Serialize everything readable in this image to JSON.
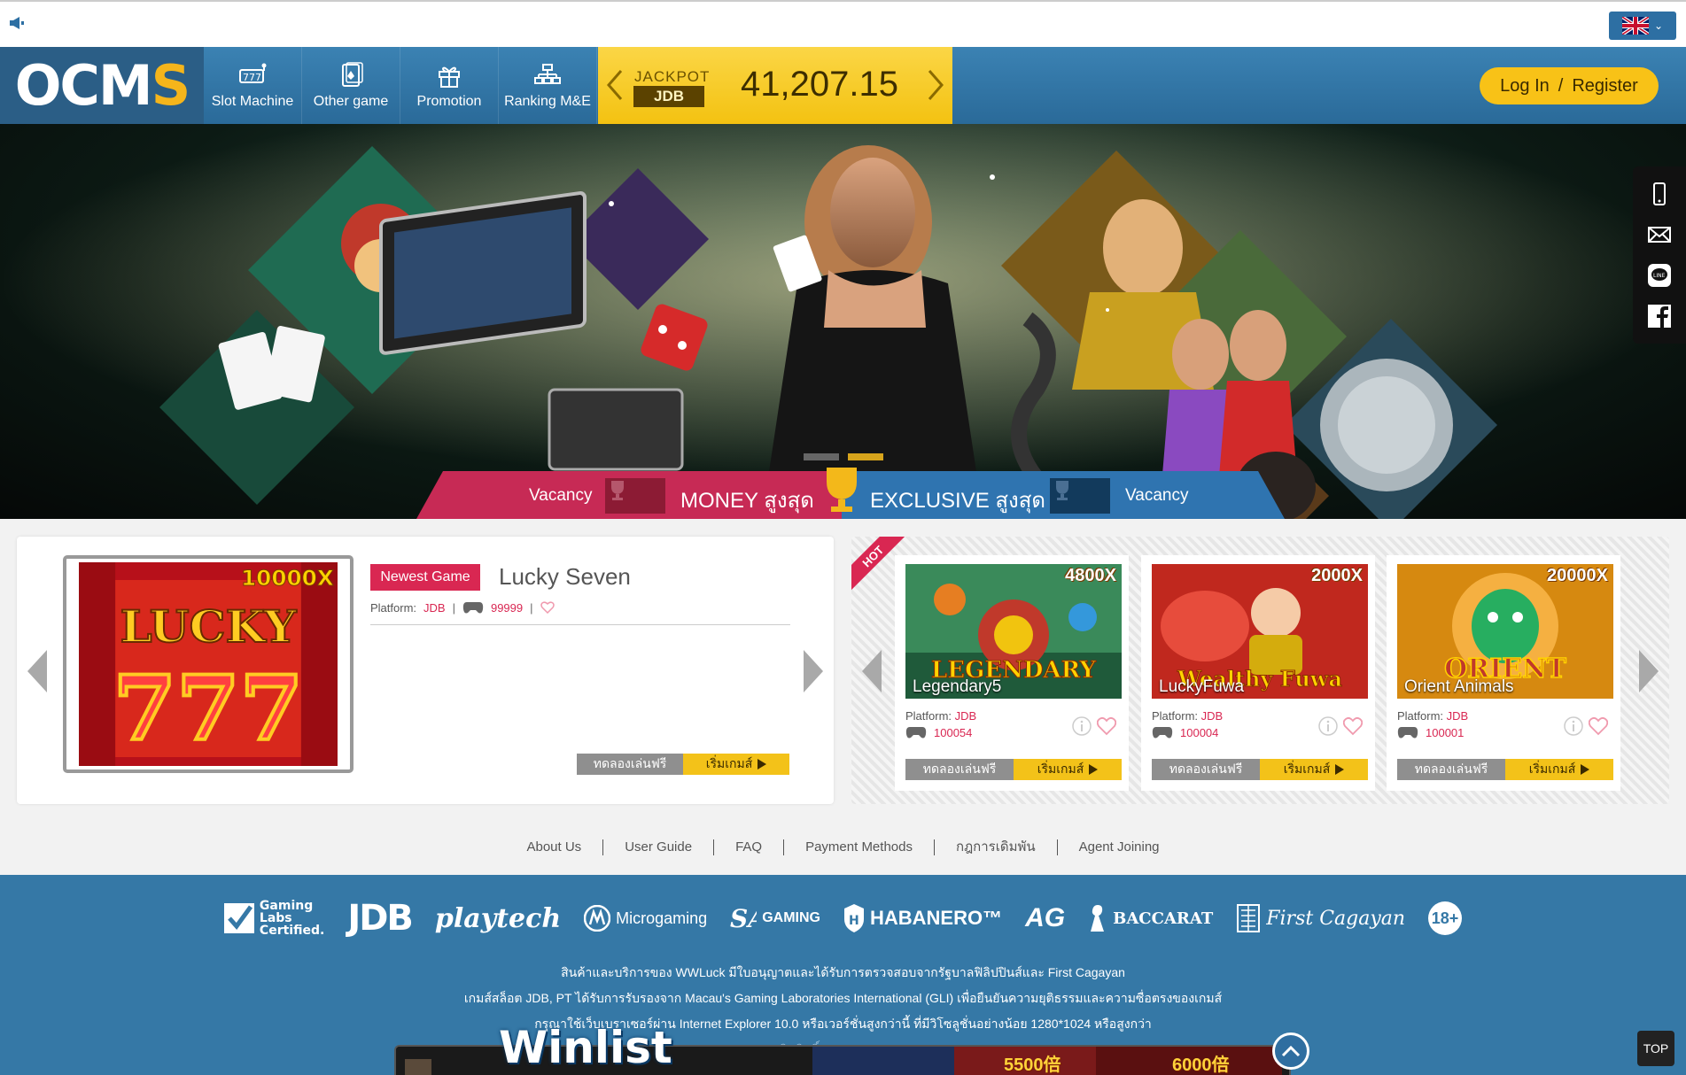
{
  "header": {
    "logo_main": "OCM",
    "logo_accent": "S",
    "nav": [
      {
        "label": "Slot Machine",
        "icon": "slot-icon"
      },
      {
        "label": "Other game",
        "icon": "cards-icon"
      },
      {
        "label": "Promotion",
        "icon": "gift-icon"
      },
      {
        "label": "Ranking M&E",
        "icon": "ranking-icon"
      }
    ],
    "jackpot": {
      "label": "JACKPOT",
      "provider": "JDB",
      "value": "41,207.15"
    },
    "login": {
      "login_label": "Log In",
      "separator": "/",
      "register_label": "Register"
    },
    "language": "flag-uk-icon"
  },
  "banner": {
    "slides_total": 2,
    "active_slide": 2,
    "rank_strip": {
      "left_vacancy": "Vacancy",
      "money_label": "MONEY สูงสุด",
      "exclusive_label": "EXCLUSIVE สูงสุด",
      "right_vacancy": "Vacancy"
    }
  },
  "side_tools": [
    "mobile-icon",
    "mail-icon",
    "line-icon",
    "facebook-icon"
  ],
  "newest_game": {
    "badge": "Newest Game",
    "title": "Lucky Seven",
    "platform_label": "Platform:",
    "platform": "JDB",
    "players": "99999",
    "thumb_multiplier": "10000X",
    "thumb_text_1": "LUCKY",
    "thumb_text_2": "777",
    "try_label": "ทดลองเล่นฟรี",
    "play_label": "เริ่มเกมส์"
  },
  "hot_games": {
    "ribbon": "HOT",
    "games": [
      {
        "name": "Legendary5",
        "multiplier": "4800X",
        "platform_label": "Platform:",
        "platform": "JDB",
        "players": "100054",
        "try_label": "ทดลองเล่นฟรี",
        "play_label": "เริ่มเกมส์"
      },
      {
        "name": "LuckyFuwa",
        "multiplier": "2000X",
        "platform_label": "Platform:",
        "platform": "JDB",
        "players": "100004",
        "try_label": "ทดลองเล่นฟรี",
        "play_label": "เริ่มเกมส์"
      },
      {
        "name": "Orient Animals",
        "multiplier": "20000X",
        "platform_label": "Platform:",
        "platform": "JDB",
        "players": "100001",
        "try_label": "ทดลองเล่นฟรี",
        "play_label": "เริ่มเกมส์"
      }
    ]
  },
  "footer_links": [
    "About Us",
    "User Guide",
    "FAQ",
    "Payment Methods",
    "กฎการเดิมพัน",
    "Agent Joining"
  ],
  "partners": {
    "glc": [
      "Gaming",
      "Labs",
      "Certified."
    ],
    "jdb": "JDB",
    "playtech": "playtech",
    "microgaming": "Microgaming",
    "sa_gaming": "GAMING",
    "habanero": "HABANERO™",
    "ag": "AG",
    "sexy_baccarat": "BACCARAT",
    "first_cagayan": "First Cagayan",
    "age": "18+"
  },
  "footer_text": {
    "line1": "สินค้าและบริการของ WWLuck มีใบอนุญาตและได้รับการตรวจสอบจากรัฐบาลฟิลิปปินส์และ First Cagayan",
    "line2": "เกมส์สล็อต JDB, PT ได้รับการรับรองจาก Macau's Gaming Laboratories International (GLI) เพื่อยืนยันความยุติธรรมและความซื่อตรงของเกมส์",
    "line3": "กรุณาใช้เว็บเบราเซอร์ผ่าน Internet Explorer 10.0 หรือเวอร์ชั่นสูงกว่านี้ ที่มีวิโซลูชั่นอย่างน้อย 1280*1024 หรือสูงกว่า",
    "copyright": "ลิขสิทธิ์ของ © WWLuck"
  },
  "winlist": {
    "title": "Winlist",
    "mult_1": "5500倍",
    "mult_2": "6000倍"
  },
  "top_button": "TOP",
  "colors": {
    "header": "#3b82b3",
    "jackpot": "#f3c211",
    "accent_pink": "#d92752",
    "footer": "#3578a6"
  }
}
